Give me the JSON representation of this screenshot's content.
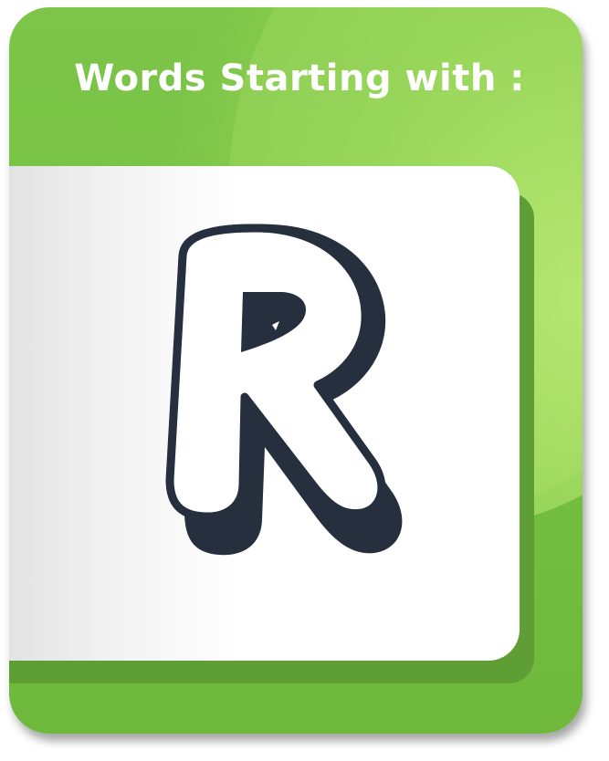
{
  "card": {
    "title": "Words Starting with :",
    "letter": "R",
    "colors": {
      "card_green": "#74bf42",
      "highlight_green": "#a9dc63",
      "panel": "#ffffff",
      "letter_outline": "#252f3d",
      "title_text": "#ffffff"
    }
  }
}
